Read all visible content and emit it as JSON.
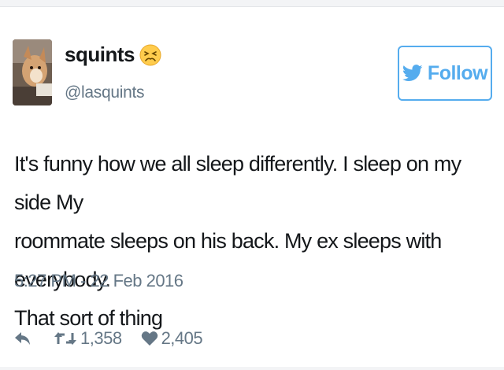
{
  "tweet": {
    "display_name": "squints",
    "name_emoji": "persevering-face-emoji",
    "handle": "@lasquints",
    "follow_label": "Follow",
    "text_lines": [
      "It's funny how we all sleep differently. I sleep on my side My",
      "roommate sleeps on his back. My ex sleeps with everybody.",
      "That sort of thing"
    ],
    "timestamp": "5:27 PM - 22 Feb 2016",
    "retweets": "1,358",
    "likes": "2,405"
  },
  "icons": {
    "reply": "reply-arrow-icon",
    "retweet": "retweet-icon",
    "like": "heart-icon",
    "follow": "twitter-bird-icon"
  },
  "colors": {
    "accent": "#55acee",
    "text": "#14171a",
    "muted": "#657786"
  }
}
